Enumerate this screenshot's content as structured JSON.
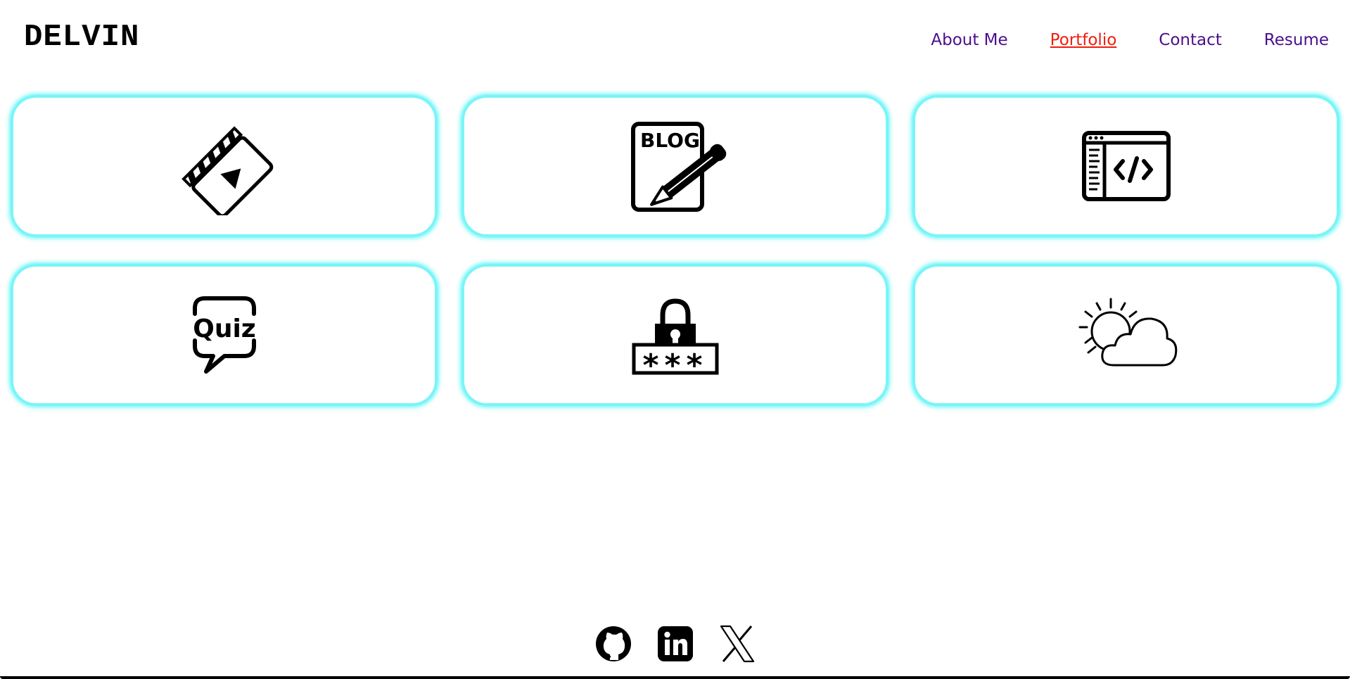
{
  "header": {
    "logo": "DELVIN"
  },
  "nav": {
    "items": [
      {
        "label": "About Me",
        "active": false
      },
      {
        "label": "Portfolio",
        "active": true
      },
      {
        "label": "Contact",
        "active": false
      },
      {
        "label": "Resume",
        "active": false
      }
    ]
  },
  "portfolio": {
    "cards": [
      {
        "icon": "film-clapperboard-icon"
      },
      {
        "icon": "blog-pencil-icon",
        "icon_text": "BLOG"
      },
      {
        "icon": "code-window-icon"
      },
      {
        "icon": "quiz-speech-bubble-icon",
        "icon_text": "Quiz"
      },
      {
        "icon": "password-lock-icon",
        "icon_text": "***"
      },
      {
        "icon": "weather-sun-cloud-icon"
      }
    ]
  },
  "footer": {
    "links": [
      {
        "icon": "github-icon"
      },
      {
        "icon": "linkedin-icon"
      },
      {
        "icon": "x-twitter-icon"
      }
    ]
  },
  "colors": {
    "nav_link": "#4b0f8c",
    "nav_active": "#f01d0d",
    "card_glow": "#20f0f5"
  }
}
